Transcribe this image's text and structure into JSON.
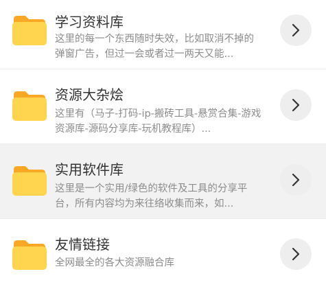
{
  "items": [
    {
      "title": "学习资料库",
      "desc_line1": "这里的每一个东西随时失效，比如取消不掉的",
      "desc_line2": "弹窗广告，但过一会或者过一两天又能...",
      "icon": "folder-icon",
      "action_icon": "chevron-right-icon"
    },
    {
      "title": "资源大杂烩",
      "desc_line1": "这里有（马子-打码-ip-搬砖工具-悬赏合集-游戏",
      "desc_line2": "资源库-源码分享库-玩机教程库）...",
      "icon": "folder-icon",
      "action_icon": "chevron-right-icon"
    },
    {
      "title": "实用软件库",
      "desc_line1": "这里是一个实用/绿色的软件及工具的分享平",
      "desc_line2": "台，所有内容均为来往络收集而来，如...",
      "icon": "folder-icon",
      "action_icon": "chevron-right-icon"
    },
    {
      "title": "友情链接",
      "desc_line1": "全网最全的各大资源融合库",
      "icon": "folder-icon",
      "action_icon": "chevron-right-icon"
    }
  ],
  "colors": {
    "folder_front": "#FFD54F",
    "folder_back": "#F9A825",
    "highlight_row": "#F2F2F2",
    "title_text": "#333333",
    "desc_text": "#8C8C8C"
  }
}
